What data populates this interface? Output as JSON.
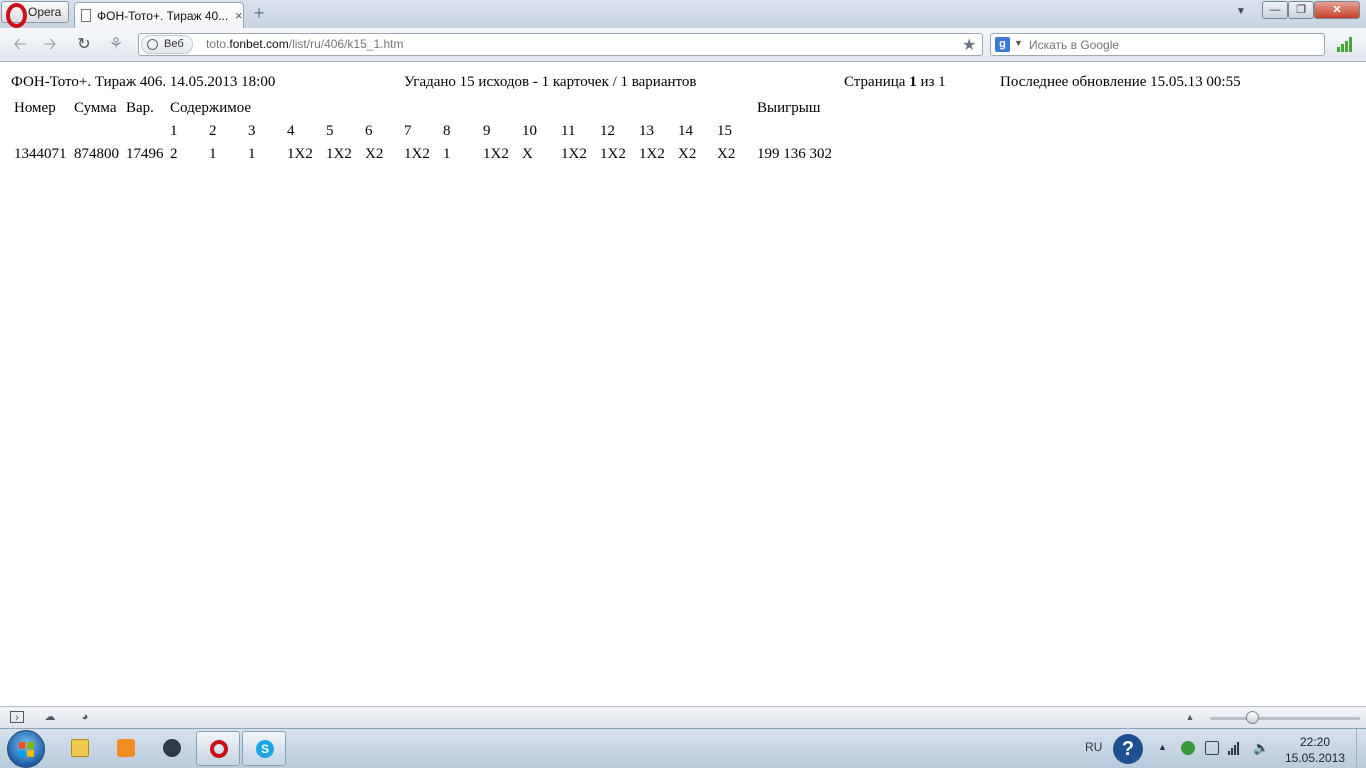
{
  "browser": {
    "menu_label": "Opera",
    "tab_title": "ФОН-Тото+. Тираж 40...",
    "tab_close": "×",
    "new_tab": "+",
    "address": {
      "badge": "Веб",
      "url_prefix": "toto.",
      "url_domain": "fonbet.com",
      "url_path": "/list/ru/406/k15_1.htm"
    },
    "search": {
      "engine": "g",
      "placeholder": "Искать в Google"
    }
  },
  "page": {
    "title": "ФОН-Тото+. Тираж 406. 14.05.2013 18:00",
    "guessed": "Угадано 15 исходов - 1 карточек / 1 вариантов",
    "page_info": {
      "prefix": "Страница ",
      "current": "1",
      "sep": " из ",
      "total": "1"
    },
    "updated": "Последнее обновление 15.05.13 00:55",
    "table": {
      "headers": {
        "number": "Номер",
        "sum": "Сумма",
        "var": "Вар.",
        "content": "Содержимое",
        "win": "Выигрыш"
      },
      "event_numbers": [
        "1",
        "2",
        "3",
        "4",
        "5",
        "6",
        "7",
        "8",
        "9",
        "10",
        "11",
        "12",
        "13",
        "14",
        "15"
      ],
      "rows": [
        {
          "number": "1344071",
          "sum": "874800",
          "var": "17496",
          "outcomes": [
            "2",
            "1",
            "1",
            "1X2",
            "1X2",
            "X2",
            "1X2",
            "1",
            "1X2",
            "X",
            "1X2",
            "1X2",
            "1X2",
            "X2",
            "X2"
          ],
          "win": "199 136 302"
        }
      ]
    }
  },
  "taskbar": {
    "lang": "RU",
    "help": "?",
    "time": "22:20",
    "date": "15.05.2013"
  },
  "colors": {
    "opera_red": "#cc0f16",
    "signal_green": "#40a830",
    "help_blue": "#1e4f90"
  }
}
